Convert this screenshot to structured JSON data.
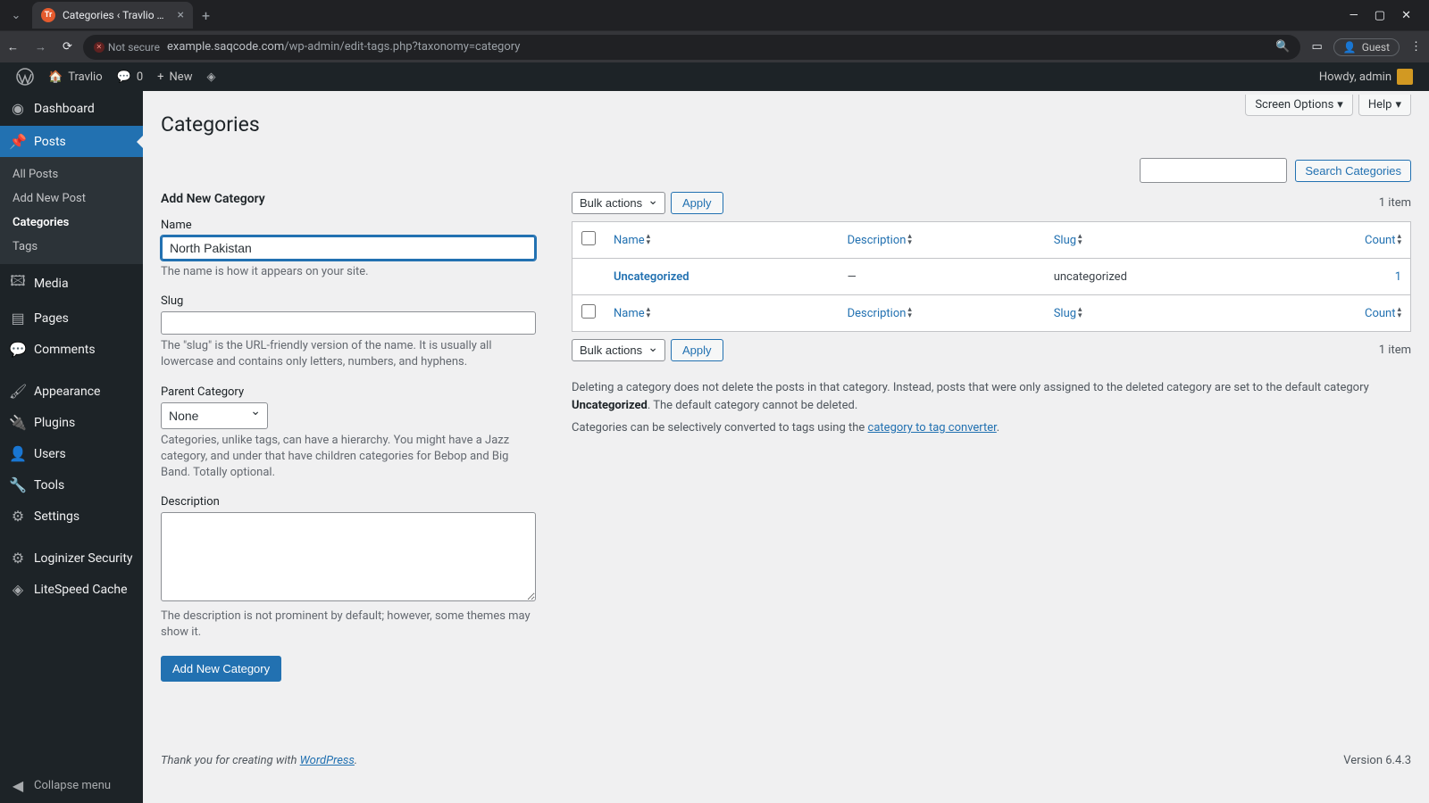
{
  "browser": {
    "tab_title": "Categories ‹ Travlio — WordPre",
    "not_secure": "Not secure",
    "url_host": "example.saqcode.com",
    "url_path": "/wp-admin/edit-tags.php?taxonomy=category",
    "guest": "Guest"
  },
  "adminbar": {
    "site": "Travlio",
    "comments": "0",
    "new": "New",
    "howdy": "Howdy, admin"
  },
  "menu": {
    "dashboard": "Dashboard",
    "posts": "Posts",
    "posts_sub": {
      "all": "All Posts",
      "add": "Add New Post",
      "cats": "Categories",
      "tags": "Tags"
    },
    "media": "Media",
    "pages": "Pages",
    "comments": "Comments",
    "appearance": "Appearance",
    "plugins": "Plugins",
    "users": "Users",
    "tools": "Tools",
    "settings": "Settings",
    "loginizer": "Loginizer Security",
    "litespeed": "LiteSpeed Cache",
    "collapse": "Collapse menu"
  },
  "screen": {
    "options": "Screen Options",
    "help": "Help"
  },
  "page": {
    "title": "Categories",
    "form_title": "Add New Category",
    "name_label": "Name",
    "name_value": "North Pakistan",
    "name_desc": "The name is how it appears on your site.",
    "slug_label": "Slug",
    "slug_value": "",
    "slug_desc": "The \"slug\" is the URL-friendly version of the name. It is usually all lowercase and contains only letters, numbers, and hyphens.",
    "parent_label": "Parent Category",
    "parent_value": "None",
    "parent_desc": "Categories, unlike tags, can have a hierarchy. You might have a Jazz category, and under that have children categories for Bebop and Big Band. Totally optional.",
    "desc_label": "Description",
    "desc_value": "",
    "desc_desc": "The description is not prominent by default; however, some themes may show it.",
    "submit": "Add New Category"
  },
  "list": {
    "search_btn": "Search Categories",
    "bulk": "Bulk actions",
    "apply": "Apply",
    "count_text": "1 item",
    "cols": {
      "name": "Name",
      "desc": "Description",
      "slug": "Slug",
      "count": "Count"
    },
    "rows": [
      {
        "name": "Uncategorized",
        "desc": "—",
        "slug": "uncategorized",
        "count": "1"
      }
    ],
    "note1a": "Deleting a category does not delete the posts in that category. Instead, posts that were only assigned to the deleted category are set to the default category ",
    "note1b": "Uncategorized",
    "note1c": ". The default category cannot be deleted.",
    "note2a": "Categories can be selectively converted to tags using the ",
    "note2b": "category to tag converter",
    "note2c": "."
  },
  "footer": {
    "thanks_a": "Thank you for creating with ",
    "thanks_b": "WordPress",
    "thanks_c": ".",
    "version": "Version 6.4.3"
  }
}
